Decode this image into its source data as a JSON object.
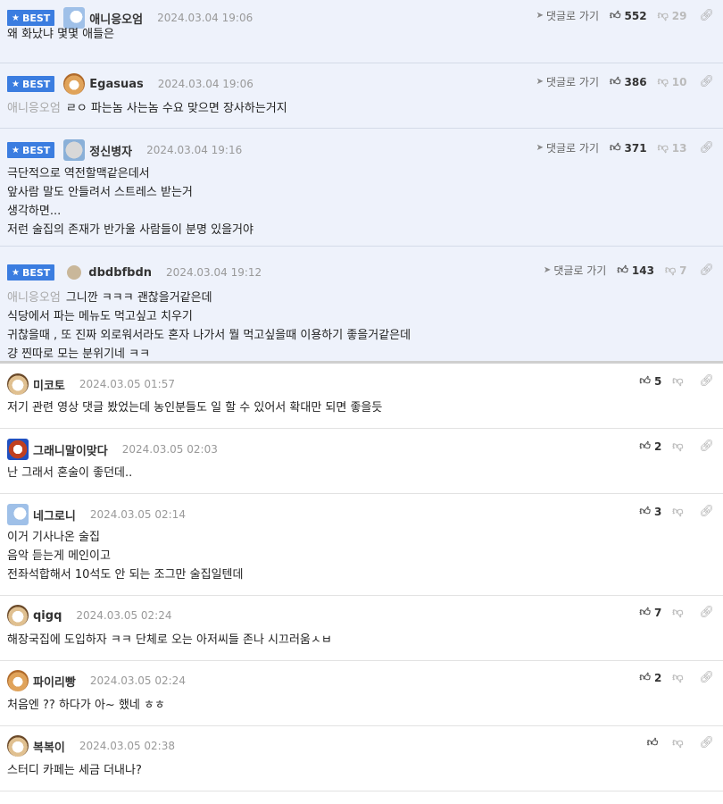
{
  "labels": {
    "best": "BEST",
    "reply": "댓글로 가기"
  },
  "icons": {
    "star": "star-icon",
    "reply": "send-arrow-icon",
    "like": "thumbs-up-icon",
    "dislike": "thumbs-down-icon",
    "link": "link-icon"
  },
  "colors": {
    "best_badge": "#3b7de0",
    "best_bg": "#eef2fb"
  },
  "comments": [
    {
      "best": true,
      "nick": "애니응오엄",
      "date": "2024.03.04 19:06",
      "likes": "552",
      "dislikes": "29",
      "reply": true,
      "quote": "",
      "lines": [
        "왜 화났냐 몇몇 애들은"
      ]
    },
    {
      "best": true,
      "nick": "Egasuas",
      "date": "2024.03.04 19:06",
      "likes": "386",
      "dislikes": "10",
      "reply": true,
      "quote": "애니응오엄",
      "lines": [
        "ㄹㅇ 파는놈 사는놈 수요 맞으면 장사하는거지"
      ]
    },
    {
      "best": true,
      "nick": "정신병자",
      "date": "2024.03.04 19:16",
      "likes": "371",
      "dislikes": "13",
      "reply": true,
      "quote": "",
      "lines": [
        "극단적으로 역전할맥같은데서",
        "앞사람 말도 안들려서 스트레스 받는거",
        "생각하면...",
        "저런 술집의 존재가 반가울 사람들이 분명 있을거야"
      ]
    },
    {
      "best": true,
      "nick": "dbdbfbdn",
      "date": "2024.03.04 19:12",
      "likes": "143",
      "dislikes": "7",
      "reply": true,
      "quote": "애니응오엄",
      "lines": [
        "그니깐 ㅋㅋㅋ 괜찮을거같은데",
        "식당에서 파는 메뉴도 먹고싶고 치우기",
        "귀찮을때 , 또 진짜 외로워서라도 혼자 나가서 뭘 먹고싶을때 이용하기 좋을거같은데",
        "걍 찐따로 모는 분위기네 ㅋㅋ"
      ]
    },
    {
      "best": false,
      "nick": "미코토",
      "date": "2024.03.05 01:57",
      "likes": "5",
      "dislikes": "",
      "reply": false,
      "quote": "",
      "lines": [
        "저기 관련 영상 댓글 봤었는데 농인분들도 일 할 수 있어서 확대만 되면 좋을듯"
      ]
    },
    {
      "best": false,
      "nick": "그래니말이맞다",
      "date": "2024.03.05 02:03",
      "likes": "2",
      "dislikes": "",
      "reply": false,
      "quote": "",
      "lines": [
        "난 그래서 혼술이 좋던데.."
      ]
    },
    {
      "best": false,
      "nick": "네그로니",
      "date": "2024.03.05 02:14",
      "likes": "3",
      "dislikes": "",
      "reply": false,
      "quote": "",
      "lines": [
        "이거 기사나온 술집",
        "음악 듣는게 메인이고",
        "전좌석합해서 10석도 안 되는 조그만 술집일텐데"
      ]
    },
    {
      "best": false,
      "nick": "qigq",
      "date": "2024.03.05 02:24",
      "likes": "7",
      "dislikes": "",
      "reply": false,
      "quote": "",
      "lines": [
        "해장국집에 도입하자 ㅋㅋ 단체로 오는 아저씨들 존나 시끄러움ㅅㅂ"
      ]
    },
    {
      "best": false,
      "nick": "파이리빵",
      "date": "2024.03.05 02:24",
      "likes": "2",
      "dislikes": "",
      "reply": false,
      "quote": "",
      "lines": [
        "처음엔 ?? 하다가 아~ 했네 ㅎㅎ"
      ]
    },
    {
      "best": false,
      "nick": "복복이",
      "date": "2024.03.05 02:38",
      "likes": "",
      "dislikes": "",
      "reply": false,
      "quote": "",
      "lines": [
        "스터디 카페는 세금 더내나?"
      ]
    }
  ]
}
